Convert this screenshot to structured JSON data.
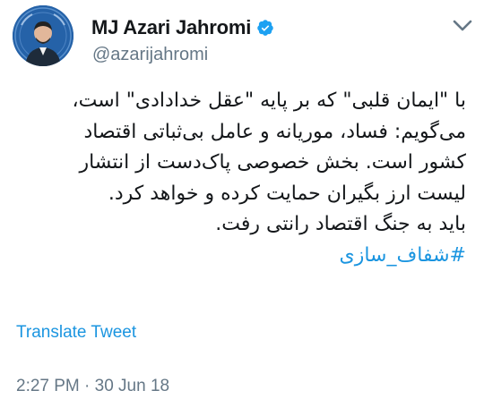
{
  "author": {
    "display_name": "MJ Azari Jahromi",
    "handle": "@azarijahromi",
    "verified_icon": "verified-badge-icon",
    "verified_color": "#1da1f2"
  },
  "tweet": {
    "lines": [
      "با \"ایمان قلبی\" که بر پایه \"عقل خدادادی\" است،",
      "می‌گویم: فساد، موریانه و عامل بی‌ثباتی اقتصاد",
      "کشور است. بخش خصوصی پاک‌دست از انتشار",
      "لیست ارز بگیران حمایت کرده و خواهد کرد.",
      "باید به جنگ اقتصاد رانتی رفت."
    ],
    "hashtag": "#شفاف_سازی",
    "translate_label": "Translate Tweet",
    "timestamp": "2:27 PM · 30 Jun 18"
  },
  "colors": {
    "link": "#1b95e0",
    "secondary_text": "#657786",
    "primary_text": "#14171a"
  }
}
